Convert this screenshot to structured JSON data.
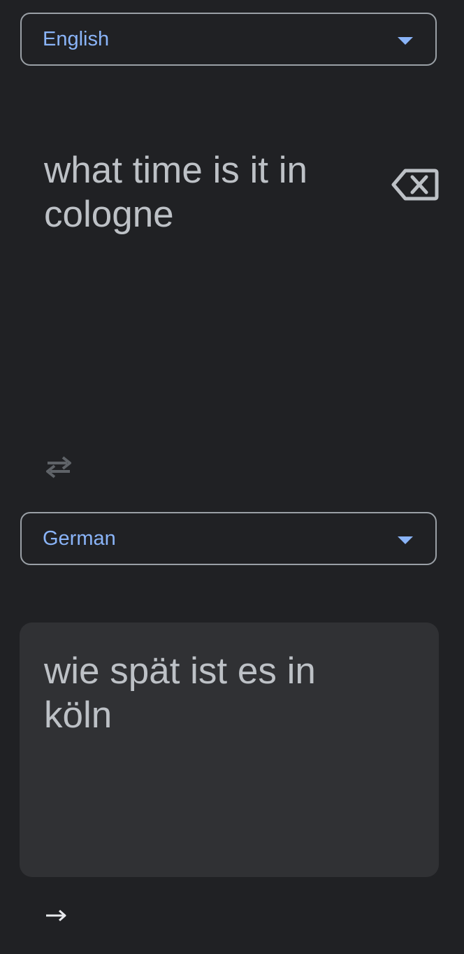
{
  "source": {
    "language": "English",
    "text": "what time is it in cologne",
    "clear_icon": "backspace-clear-icon"
  },
  "swap": {
    "icon": "swap-languages-icon"
  },
  "target": {
    "language": "German",
    "text": "wie spät ist es in köln"
  },
  "footer": {
    "icon": "arrow-right-icon"
  },
  "colors": {
    "background": "#202124",
    "accent": "#8ab4f8",
    "text": "#bdc1c6",
    "card": "#303134",
    "border": "#9aa0a6"
  }
}
